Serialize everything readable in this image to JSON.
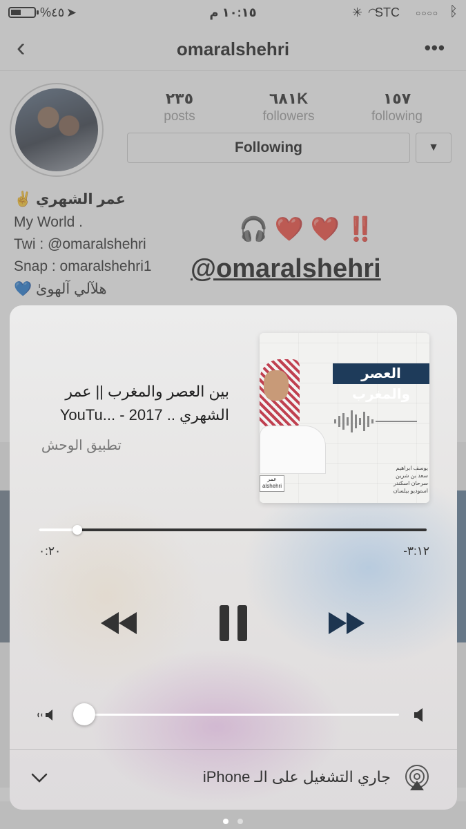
{
  "status_bar": {
    "battery": "%٤٥",
    "time": "١٠:١٥ م",
    "carrier": "STC",
    "battery_level": 0.45
  },
  "profile": {
    "username": "omaralshehri",
    "stats": [
      {
        "value": "٢٣٥",
        "label": "posts"
      },
      {
        "value": "٦٨١K",
        "label": "followers"
      },
      {
        "value": "١٥٧",
        "label": "following"
      }
    ],
    "follow_button": "Following",
    "bio": {
      "name": "عمر الشهري ✌️",
      "lines": [
        "My World .",
        "Twi : @omaralshehri",
        "Snap : omaralshehri1",
        "هلآلي آلهوىٰ 💙"
      ]
    },
    "sticker": {
      "emoji": "🎧 ❤️ ❤️ ‼️",
      "handle": "@omaralshehri"
    }
  },
  "now_playing": {
    "title": "بين العصر والمغرب || عمر الشهري .. 2017 - ...YouTu",
    "app": "تطبيق الوحش",
    "elapsed": "٠:٢٠",
    "remaining": "-٣:١٢",
    "progress": 0.1,
    "volume": 0.03,
    "output_label": "جاري التشغيل على الـ iPhone",
    "artwork": {
      "banner_text": "العصر والمغرب",
      "credits": [
        "يوسف ابراهيم",
        "سعد بن شرين",
        "سرحان اسكندر",
        "استوديو بيلسان"
      ],
      "logo_text": "عمر alshehri"
    }
  },
  "page_dots": {
    "count": 2,
    "active": 0
  }
}
